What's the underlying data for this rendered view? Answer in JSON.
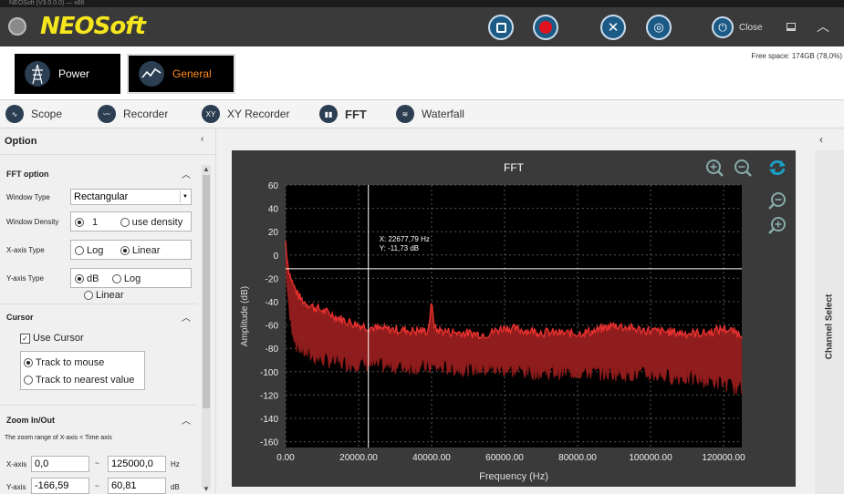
{
  "window": {
    "title": "NEOSoft (V3.0.0.0)  —  x86"
  },
  "app": {
    "brand": "NEOSoft",
    "close_label": "Close",
    "free_space": "Free space: 174GB (78,0%)"
  },
  "modes": [
    {
      "label": "Power",
      "icon": "power-tower-icon"
    },
    {
      "label": "General",
      "icon": "waveform-icon",
      "active": true
    }
  ],
  "tabs": [
    {
      "label": "Scope",
      "icon": "scope-icon"
    },
    {
      "label": "Recorder",
      "icon": "recorder-icon"
    },
    {
      "label": "XY Recorder",
      "icon": "xy-icon"
    },
    {
      "label": "FFT",
      "icon": "fft-icon",
      "active": true
    },
    {
      "label": "Waterfall",
      "icon": "waterfall-icon"
    }
  ],
  "option_panel": {
    "title": "Option",
    "fft_option": {
      "header": "FFT option",
      "window_type_label": "Window Type",
      "window_type_value": "Rectangular",
      "window_density_label": "Window Density",
      "window_density_value": "1",
      "use_density_label": "use density",
      "x_axis_type_label": "X-axis Type",
      "x_options": [
        "Log",
        "Linear"
      ],
      "x_selected": "Linear",
      "y_axis_type_label": "Y-axis Type",
      "y_options": [
        "dB",
        "Log",
        "Linear"
      ],
      "y_selected": "dB"
    },
    "cursor": {
      "header": "Cursor",
      "use_cursor_label": "Use Cursor",
      "use_cursor_checked": true,
      "track_mouse": "Track to mouse",
      "track_nearest": "Track to nearest value",
      "selected": "Track to mouse"
    },
    "zoom": {
      "header": "Zoom In/Out",
      "note": "The zoom range of X-axis < Time axis",
      "x_label": "X-axis",
      "x_min": "0,0",
      "x_max": "125000,0",
      "x_unit": "Hz",
      "y_label": "Y-axis",
      "y_min": "-166,59",
      "y_max": "60,81",
      "y_unit": "dB",
      "sep": "~"
    }
  },
  "side_panel": {
    "label": "Channel Select"
  },
  "chart_data": {
    "type": "line",
    "title": "FFT",
    "xlabel": "Frequency  (Hz)",
    "ylabel": "Amplitude (dB)",
    "xlim": [
      0,
      125000
    ],
    "ylim": [
      -165,
      60
    ],
    "x_ticks": [
      "0.00",
      "20000.00",
      "40000.00",
      "60000.00",
      "80000.00",
      "100000.00",
      "120000.00"
    ],
    "y_ticks": [
      "60",
      "40",
      "20",
      "0",
      "-20",
      "-40",
      "-60",
      "-80",
      "-100",
      "-120",
      "-140",
      "-160"
    ],
    "grid": true,
    "cursor": {
      "x": 22677.79,
      "y": -11.73,
      "x_text": "X:  22677,79 Hz",
      "y_text": "Y:  -11,73 dB"
    },
    "series": [
      {
        "color": "#e8312f",
        "x": [
          0,
          500,
          1000,
          2000,
          3500,
          5000,
          8000,
          12000,
          16000,
          20000,
          25000,
          30000,
          35000,
          39000,
          40000,
          41000,
          45000,
          50000,
          55000,
          60000,
          64000,
          70000,
          75000,
          80000,
          85000,
          90000,
          95000,
          100000,
          105000,
          110000,
          115000,
          120000,
          122000,
          125000
        ],
        "values": [
          12,
          -5,
          -15,
          -25,
          -35,
          -40,
          -45,
          -50,
          -56,
          -60,
          -63,
          -64,
          -65,
          -65,
          -42,
          -64,
          -66,
          -67,
          -68,
          -62,
          -64,
          -66,
          -67,
          -67,
          -65,
          -60,
          -63,
          -65,
          -66,
          -67,
          -67,
          -63,
          -65,
          -68
        ]
      },
      {
        "color": "#8a1a1a",
        "x": [
          0,
          1000,
          3000,
          6000,
          10000,
          15000,
          20000,
          30000,
          40000,
          50000,
          60000,
          70000,
          80000,
          90000,
          100000,
          110000,
          120000,
          125000
        ],
        "values": [
          -10,
          -55,
          -80,
          -88,
          -92,
          -95,
          -96,
          -98,
          -99,
          -100,
          -101,
          -103,
          -103,
          -104,
          -105,
          -108,
          -112,
          -118
        ]
      }
    ]
  }
}
